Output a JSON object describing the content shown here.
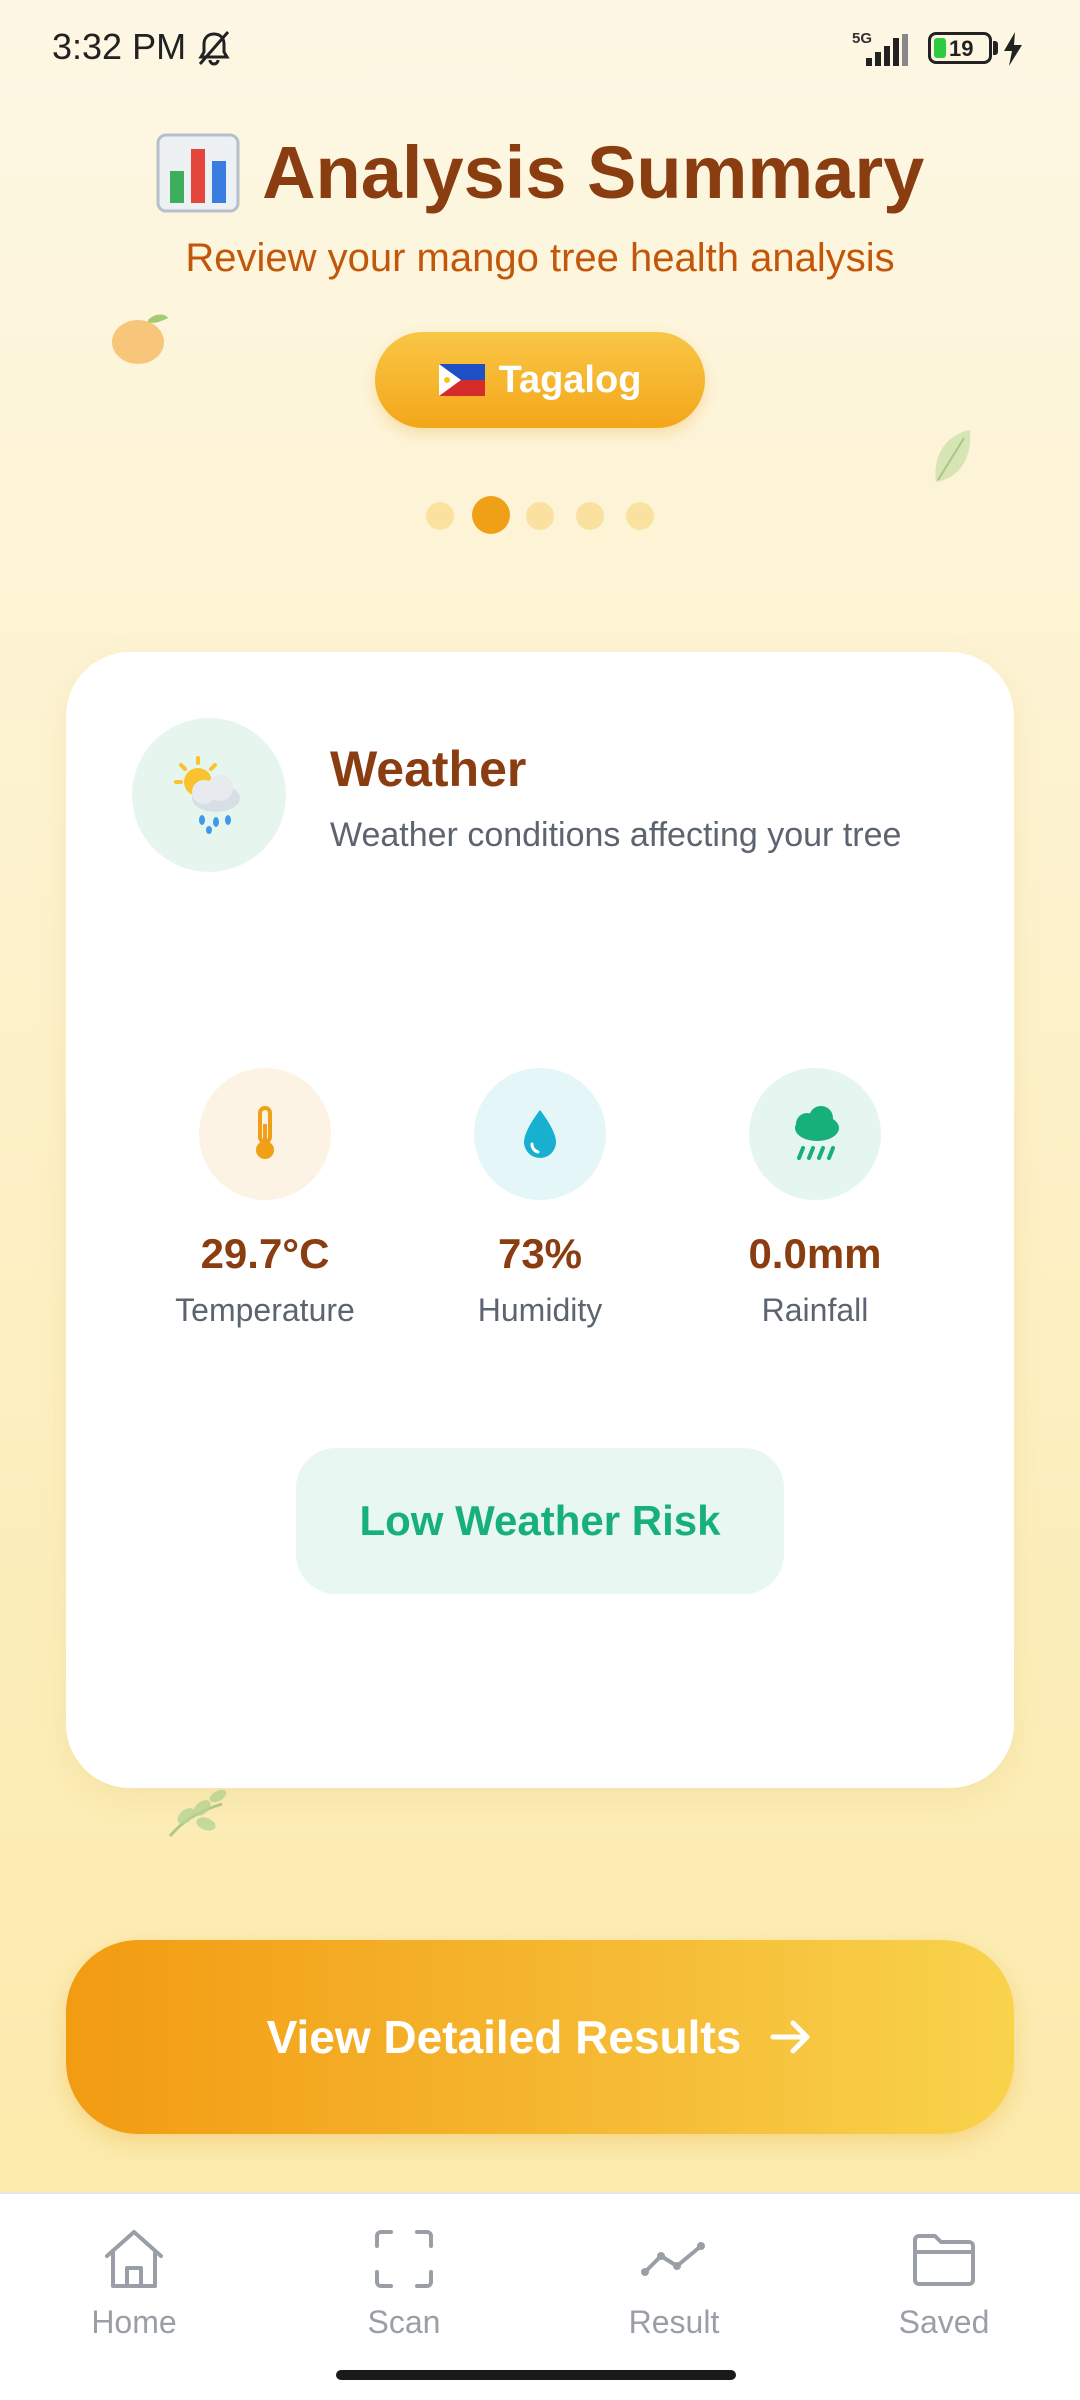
{
  "status_bar": {
    "time": "3:32 PM",
    "network": "5G",
    "battery": "19"
  },
  "header": {
    "title": "Analysis Summary",
    "subtitle": "Review your mango tree health analysis",
    "language_button": "Tagalog"
  },
  "carousel": {
    "total": 5,
    "active_index": 1
  },
  "weather_card": {
    "title": "Weather",
    "description": "Weather conditions affecting your tree",
    "metrics": [
      {
        "value": "29.7°C",
        "label": "Temperature",
        "icon": "thermometer-icon"
      },
      {
        "value": "73%",
        "label": "Humidity",
        "icon": "water-drop-icon"
      },
      {
        "value": "0.0mm",
        "label": "Rainfall",
        "icon": "rain-cloud-icon"
      }
    ],
    "risk_label": "Low Weather Risk"
  },
  "cta": {
    "label": "View Detailed Results"
  },
  "bottom_nav": [
    {
      "label": "Home",
      "icon": "home-icon"
    },
    {
      "label": "Scan",
      "icon": "scan-icon"
    },
    {
      "label": "Result",
      "icon": "chart-line-icon"
    },
    {
      "label": "Saved",
      "icon": "folder-icon"
    }
  ],
  "colors": {
    "title": "#8a3d10",
    "accent": "#f0a016",
    "risk_text": "#18b07a",
    "risk_bg": "#e8f7f1",
    "nav_inactive": "#9a9fa7"
  }
}
